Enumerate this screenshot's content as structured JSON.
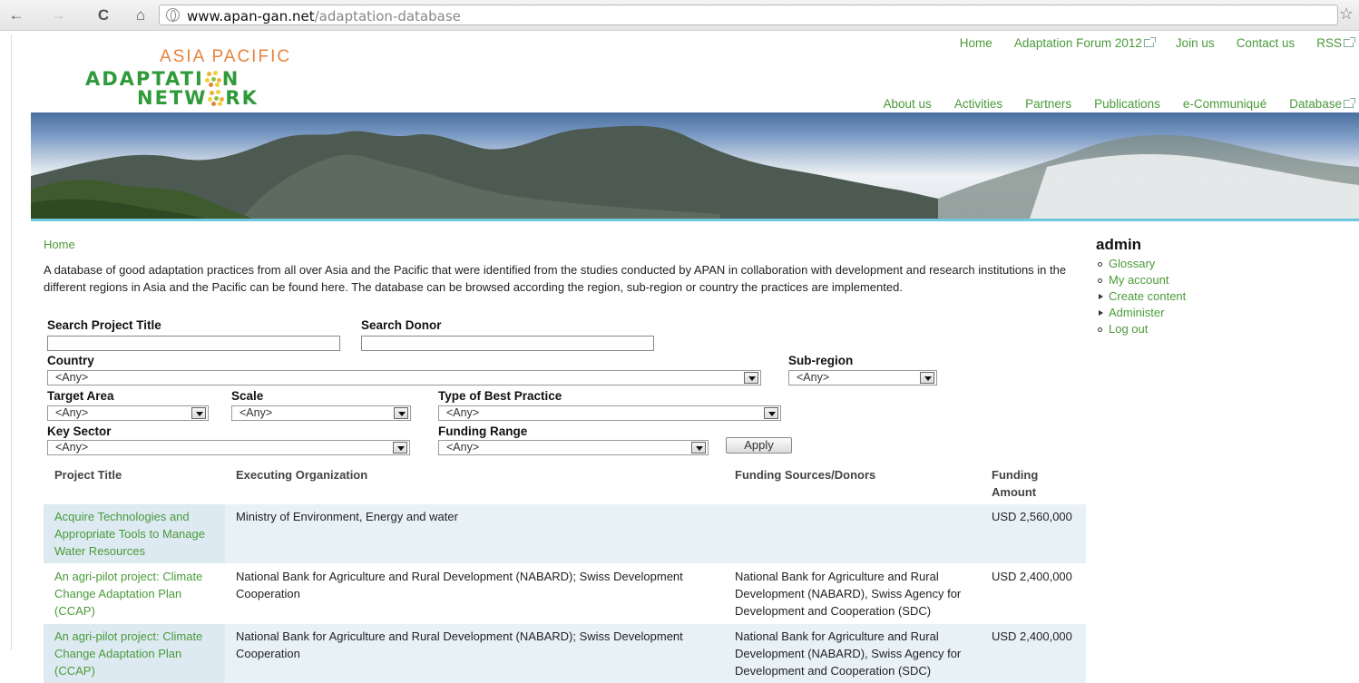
{
  "browser": {
    "url_host": "www.apan-gan.net",
    "url_path": "/adaptation-database"
  },
  "logo": {
    "line1": "ASIA PACIFIC",
    "line2_a": "ADAPTATI",
    "line2_b": "N",
    "line3_a": "NETW",
    "line3_b": "RK"
  },
  "top_links": [
    "Home",
    "Adaptation Forum 2012",
    "Join us",
    "Contact us",
    "RSS"
  ],
  "main_nav": [
    "About us",
    "Activities",
    "Partners",
    "Publications",
    "e-Communiqué",
    "Database"
  ],
  "breadcrumb": "Home",
  "intro": "A database of good adaptation practices from all over Asia and the Pacific that were identified from the studies conducted by APAN in collaboration with development and research institutions in the different regions in Asia and the Pacific can be found here. The database can be browsed according the region, sub-region or country the practices are implemented.",
  "filters": {
    "search_title_label": "Search Project Title",
    "search_title_value": "",
    "search_donor_label": "Search Donor",
    "search_donor_value": "",
    "country_label": "Country",
    "country_value": "<Any>",
    "subregion_label": "Sub-region",
    "subregion_value": "<Any>",
    "target_area_label": "Target Area",
    "target_area_value": "<Any>",
    "scale_label": "Scale",
    "scale_value": "<Any>",
    "type_label": "Type of Best Practice",
    "type_value": "<Any>",
    "key_sector_label": "Key Sector",
    "key_sector_value": "<Any>",
    "funding_range_label": "Funding Range",
    "funding_range_value": "<Any>",
    "apply_label": "Apply"
  },
  "table": {
    "headers": [
      "Project Title",
      "Executing Organization",
      "Funding Sources/Donors",
      "Funding Amount"
    ],
    "rows": [
      {
        "title": "Acquire Technologies and Appropriate Tools to Manage Water Resources",
        "org": "Ministry of Environment, Energy and water",
        "donors": "",
        "amount": "USD 2,560,000"
      },
      {
        "title": "An agri-pilot project: Climate Change Adaptation Plan (CCAP)",
        "org": "National Bank for Agriculture and Rural Development (NABARD); Swiss Development Cooperation",
        "donors": "National Bank for Agriculture and Rural Development (NABARD), Swiss Agency for Development and Cooperation (SDC)",
        "amount": "USD 2,400,000"
      },
      {
        "title": "An agri-pilot project: Climate Change Adaptation Plan (CCAP)",
        "org": "National Bank for Agriculture and Rural Development (NABARD); Swiss Development Cooperation",
        "donors": "National Bank for Agriculture and Rural Development (NABARD), Swiss Agency for Development and Cooperation (SDC)",
        "amount": "USD 2,400,000"
      }
    ]
  },
  "sidebar": {
    "title": "admin",
    "items": [
      {
        "label": "Glossary",
        "bullet": "circle"
      },
      {
        "label": "My account",
        "bullet": "circle"
      },
      {
        "label": "Create content",
        "bullet": "triangle"
      },
      {
        "label": "Administer",
        "bullet": "triangle"
      },
      {
        "label": "Log out",
        "bullet": "circle"
      }
    ]
  },
  "colors": {
    "link_green": "#4a9a3a",
    "logo_orange": "#e8823d",
    "logo_green": "#2f9a3a",
    "row_alt": "#e8f1f6",
    "banner_rule": "#6fc7de"
  }
}
